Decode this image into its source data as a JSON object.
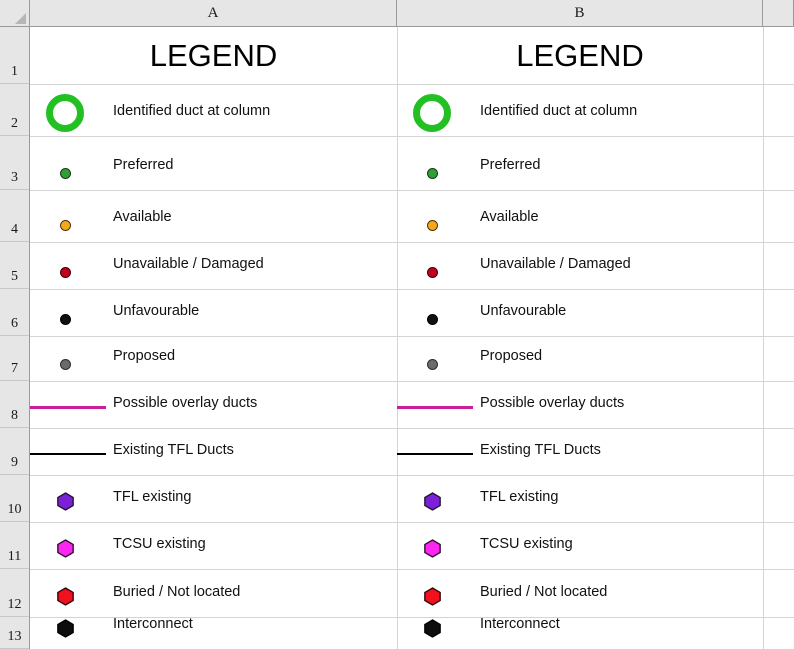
{
  "app": {
    "type": "spreadsheet",
    "select_all_icon": "select-all-triangle"
  },
  "grid": {
    "column_headers": [
      "A",
      "B"
    ],
    "row_headers": [
      "1",
      "2",
      "3",
      "4",
      "5",
      "6",
      "7",
      "8",
      "9",
      "10",
      "11",
      "12",
      "13"
    ]
  },
  "legend": {
    "title": "LEGEND",
    "entries": [
      {
        "row": "2",
        "label": "Identified duct at column",
        "marker": "ring",
        "marker_name": "green-ring-icon",
        "color": "#22c022",
        "outline": "#22c022"
      },
      {
        "row": "3",
        "label": "Preferred",
        "marker": "dot",
        "marker_name": "green-dot-icon",
        "color": "#2f9e35",
        "outline": "#16391a"
      },
      {
        "row": "4",
        "label": "Available",
        "marker": "dot",
        "marker_name": "amber-dot-icon",
        "color": "#f5a81c",
        "outline": "#4a3408"
      },
      {
        "row": "5",
        "label": "Unavailable / Damaged",
        "marker": "dot",
        "marker_name": "dark-red-dot-icon",
        "color": "#c0001e",
        "outline": "#3d0009"
      },
      {
        "row": "6",
        "label": "Unfavourable",
        "marker": "dot",
        "marker_name": "black-dot-icon",
        "color": "#101010",
        "outline": "#000000"
      },
      {
        "row": "7",
        "label": "Proposed",
        "marker": "dot",
        "marker_name": "grey-dot-icon",
        "color": "#6b6b6b",
        "outline": "#2b2b2b"
      },
      {
        "row": "8",
        "label": "Possible overlay ducts",
        "marker": "line",
        "marker_name": "magenta-line-icon",
        "color": "#cc1e9a",
        "outline": "#cc1e9a"
      },
      {
        "row": "9",
        "label": "Existing TFL Ducts",
        "marker": "line",
        "marker_name": "black-line-icon",
        "color": "#000000",
        "outline": "#000000"
      },
      {
        "row": "10",
        "label": "TFL existing",
        "marker": "hexagon",
        "marker_name": "purple-hexagon-icon",
        "color": "#7b1fd8",
        "outline": "#24102f"
      },
      {
        "row": "11",
        "label": "TCSU existing",
        "marker": "hexagon",
        "marker_name": "magenta-hexagon-icon",
        "color": "#fb26ef",
        "outline": "#2b0a2a"
      },
      {
        "row": "12",
        "label": "Buried / Not located",
        "marker": "hexagon",
        "marker_name": "red-hexagon-icon",
        "color": "#f0101e",
        "outline": "#2c0306"
      },
      {
        "row": "13",
        "label": "Interconnect",
        "marker": "hexagon",
        "marker_name": "black-hexagon-icon",
        "color": "#0d0d0d",
        "outline": "#000000"
      }
    ]
  },
  "colors": {
    "header_bg": "#e6e6e6",
    "header_border": "#9a9a9a",
    "gridline": "#d4d4d4",
    "sheet_bg": "#ffffff",
    "text": "#111111"
  }
}
